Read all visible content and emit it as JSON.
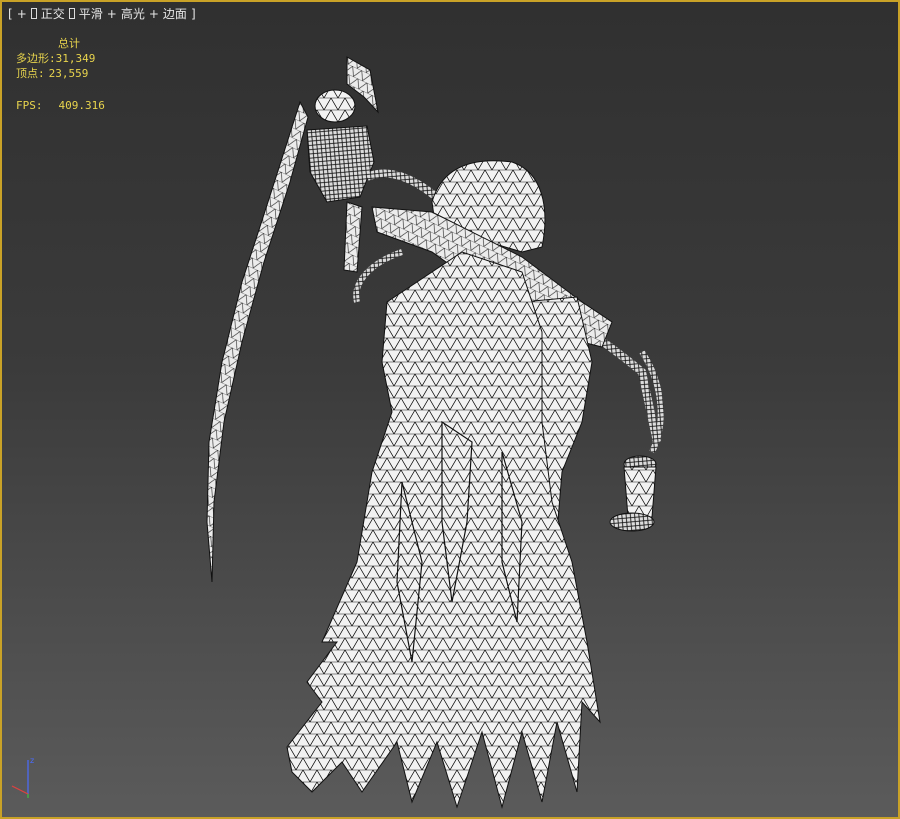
{
  "viewport": {
    "label": {
      "open": "[",
      "plus1": "+",
      "view": "正交",
      "shading": "平滑",
      "plus2": "+",
      "highlights": "高光",
      "plus3": "+",
      "edged": "边面",
      "close": "]"
    },
    "stats": {
      "header": "总计",
      "polygons_label": "多边形:",
      "polygons_value": "31,349",
      "vertices_label": "顶点:",
      "vertices_value": "23,559",
      "fps_label": "FPS:",
      "fps_value": "409.316"
    },
    "gizmo": {
      "axis_z": "z"
    },
    "colors": {
      "border": "#c9a227",
      "stats_text": "#e8d44d",
      "mesh_fill": "#f2f2f2",
      "wire": "#111111"
    }
  }
}
